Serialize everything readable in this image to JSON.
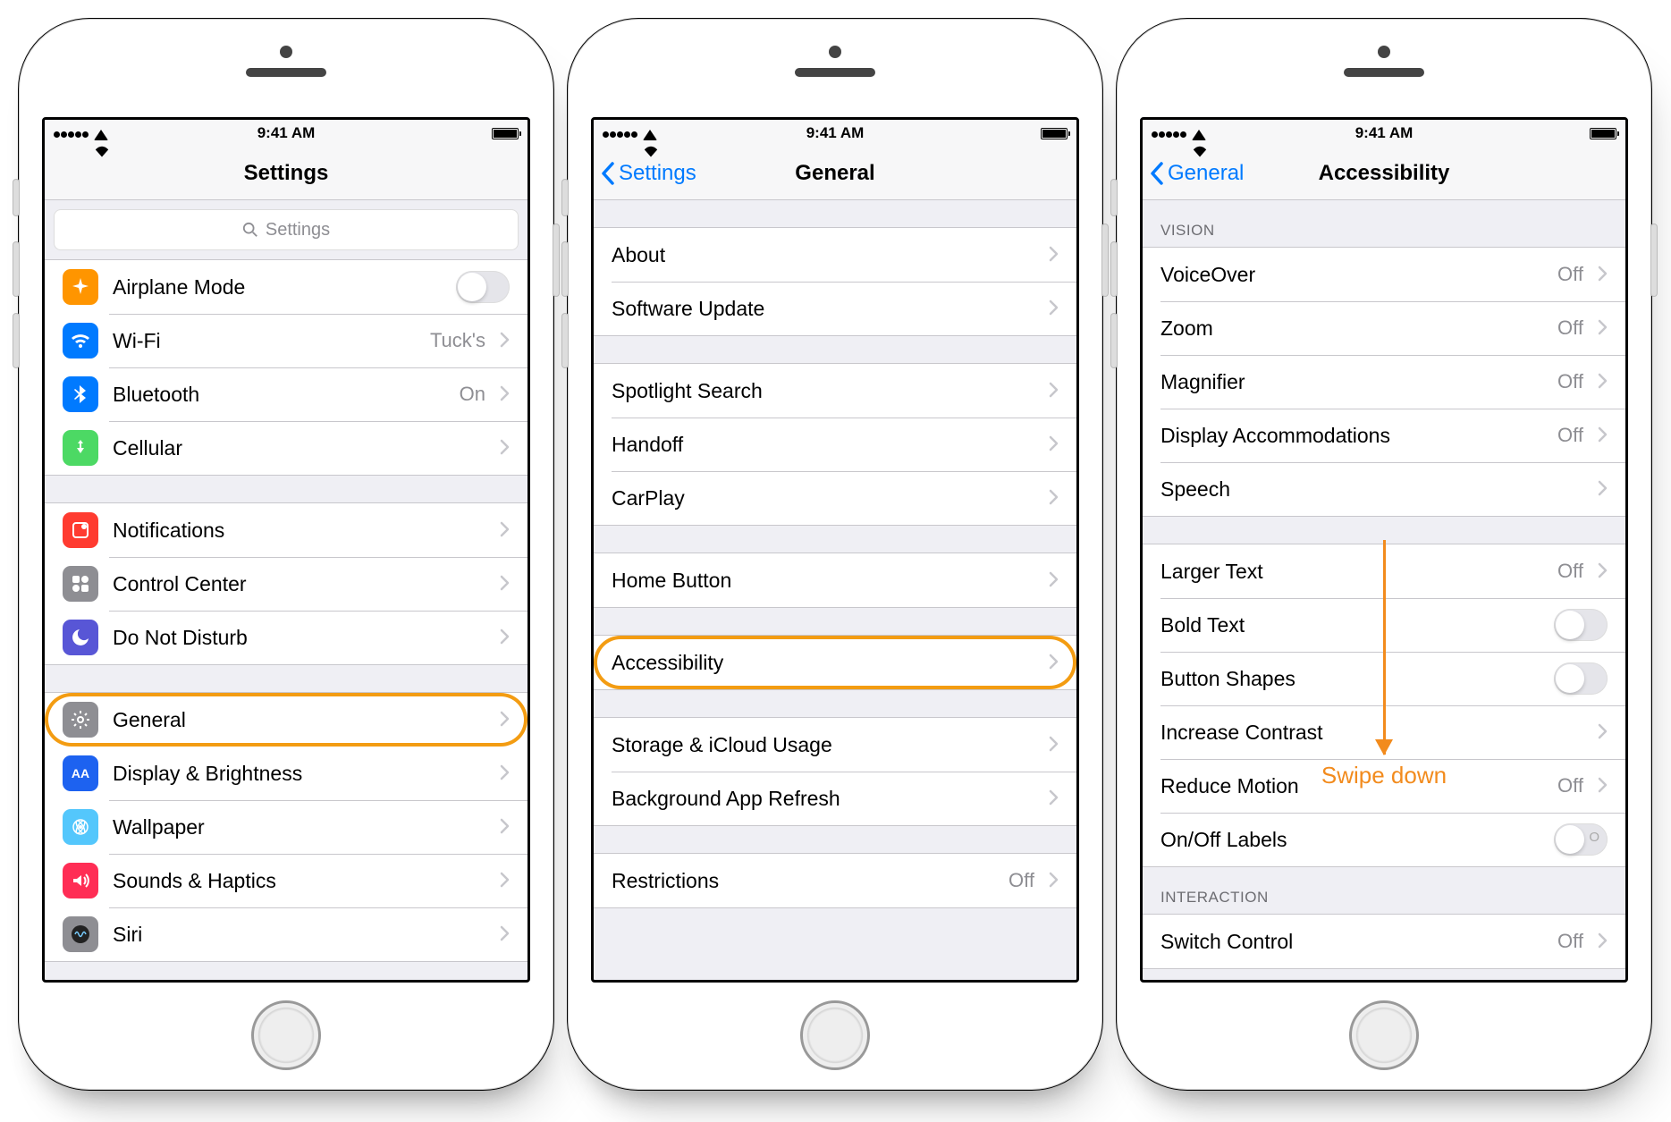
{
  "status": {
    "time": "9:41 AM"
  },
  "screen1": {
    "title": "Settings",
    "search_placeholder": "Settings",
    "groups": [
      [
        {
          "icon": "airplane-icon",
          "bg": "bg-orange",
          "label": "Airplane Mode",
          "type": "toggle",
          "value": false
        },
        {
          "icon": "wifi-icon",
          "bg": "bg-blue",
          "label": "Wi-Fi",
          "detail": "Tuck's"
        },
        {
          "icon": "bluetooth-icon",
          "bg": "bg-blue",
          "label": "Bluetooth",
          "detail": "On"
        },
        {
          "icon": "cellular-icon",
          "bg": "bg-green",
          "label": "Cellular"
        }
      ],
      [
        {
          "icon": "notifications-icon",
          "bg": "bg-red",
          "label": "Notifications"
        },
        {
          "icon": "control-center-icon",
          "bg": "bg-gray",
          "label": "Control Center"
        },
        {
          "icon": "dnd-icon",
          "bg": "bg-purple",
          "label": "Do Not Disturb"
        }
      ],
      [
        {
          "icon": "general-icon",
          "bg": "bg-gray",
          "label": "General",
          "highlight": true
        },
        {
          "icon": "display-icon",
          "bg": "bg-darkblue",
          "label": "Display & Brightness"
        },
        {
          "icon": "wallpaper-icon",
          "bg": "bg-cyan",
          "label": "Wallpaper"
        },
        {
          "icon": "sounds-icon",
          "bg": "bg-pink",
          "label": "Sounds & Haptics"
        },
        {
          "icon": "siri-icon",
          "bg": "bg-gray",
          "label": "Siri"
        }
      ]
    ]
  },
  "screen2": {
    "back": "Settings",
    "title": "General",
    "groups": [
      [
        {
          "label": "About"
        },
        {
          "label": "Software Update"
        }
      ],
      [
        {
          "label": "Spotlight Search"
        },
        {
          "label": "Handoff"
        },
        {
          "label": "CarPlay"
        }
      ],
      [
        {
          "label": "Home Button"
        }
      ],
      [
        {
          "label": "Accessibility",
          "highlight": true
        }
      ],
      [
        {
          "label": "Storage & iCloud Usage"
        },
        {
          "label": "Background App Refresh"
        }
      ],
      [
        {
          "label": "Restrictions",
          "detail": "Off"
        }
      ]
    ]
  },
  "screen3": {
    "back": "General",
    "title": "Accessibility",
    "sections": [
      {
        "header": "VISION",
        "rows": [
          {
            "label": "VoiceOver",
            "detail": "Off"
          },
          {
            "label": "Zoom",
            "detail": "Off"
          },
          {
            "label": "Magnifier",
            "detail": "Off"
          },
          {
            "label": "Display Accommodations",
            "detail": "Off"
          },
          {
            "label": "Speech"
          }
        ]
      },
      {
        "rows": [
          {
            "label": "Larger Text",
            "detail": "Off"
          },
          {
            "label": "Bold Text",
            "type": "toggle"
          },
          {
            "label": "Button Shapes",
            "type": "toggle"
          },
          {
            "label": "Increase Contrast"
          },
          {
            "label": "Reduce Motion",
            "detail": "Off"
          },
          {
            "label": "On/Off Labels",
            "type": "toggle",
            "labeled": true
          }
        ]
      },
      {
        "header": "INTERACTION",
        "rows": [
          {
            "label": "Switch Control",
            "detail": "Off"
          }
        ]
      }
    ],
    "swipe_hint": "Swipe down"
  }
}
